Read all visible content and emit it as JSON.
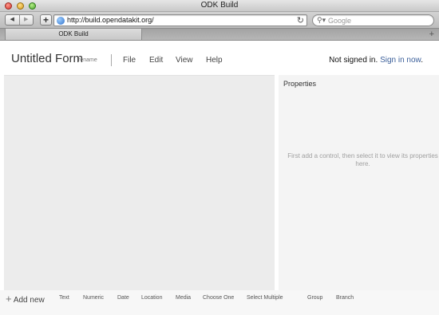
{
  "window": {
    "title": "ODK Build"
  },
  "toolbar": {
    "back": "◀",
    "forward": "▶",
    "add": "+",
    "url": "http://build.opendatakit.org/",
    "reload": "↻",
    "search_placeholder": "Google"
  },
  "tabs": [
    {
      "label": "ODK Build"
    }
  ],
  "newtab": "+",
  "header": {
    "form_title": "Untitled Form",
    "rename": "rename",
    "menu": [
      "File",
      "Edit",
      "View",
      "Help"
    ],
    "signin_text": "Not signed in.",
    "signin_link": "Sign in now",
    "signin_end": "."
  },
  "properties": {
    "title": "Properties",
    "hint": "First add a control, then select it to view its properties here."
  },
  "bottom": {
    "add_new": "Add new",
    "controls": [
      "Text",
      "Numeric",
      "Date",
      "Location",
      "Media",
      "Choose One",
      "Select Multiple",
      "Group",
      "Branch"
    ]
  }
}
